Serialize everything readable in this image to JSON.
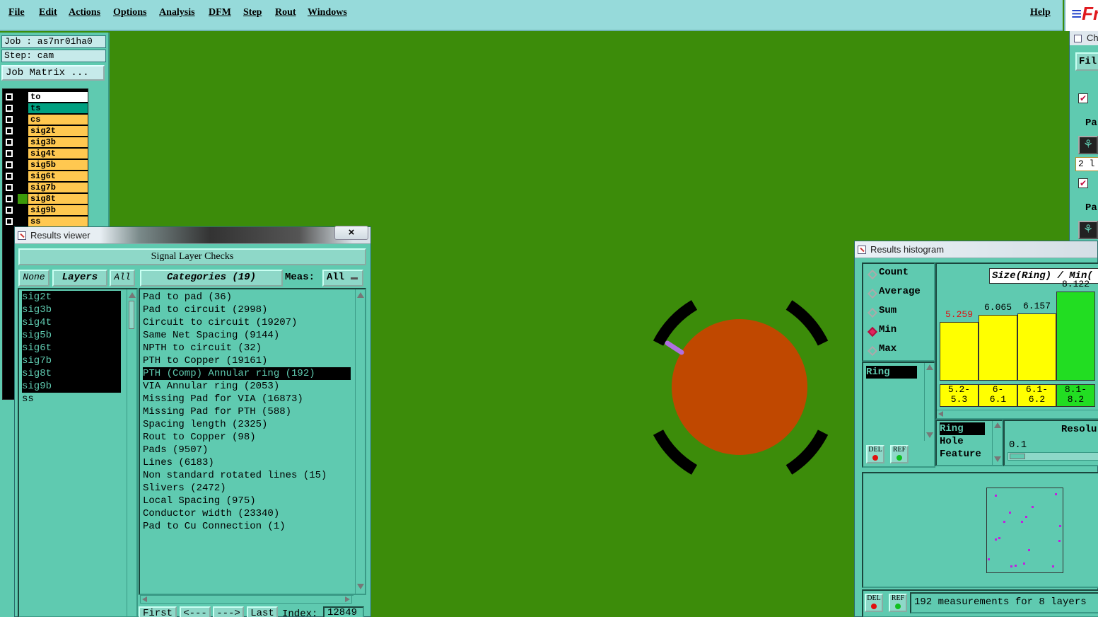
{
  "menu": {
    "items": [
      "File",
      "Edit",
      "Actions",
      "Options",
      "Analysis",
      "DFM",
      "Step",
      "Rout",
      "Windows"
    ],
    "help": "Help",
    "logo": "Fr"
  },
  "job": {
    "job_label": "Job : as7nr01ha0",
    "step_label": "Step: cam",
    "matrix_button": "Job Matrix ..."
  },
  "layers": [
    {
      "name": "to",
      "color": "#ffffff",
      "sw": "#000000"
    },
    {
      "name": "ts",
      "color": "#00a080",
      "sw": "#000000"
    },
    {
      "name": "cs",
      "color": "#ffc850",
      "sw": "#000000"
    },
    {
      "name": "sig2t",
      "color": "#ffc850",
      "sw": "#000000"
    },
    {
      "name": "sig3b",
      "color": "#ffc850",
      "sw": "#000000"
    },
    {
      "name": "sig4t",
      "color": "#ffc850",
      "sw": "#000000"
    },
    {
      "name": "sig5b",
      "color": "#ffc850",
      "sw": "#000000"
    },
    {
      "name": "sig6t",
      "color": "#ffc850",
      "sw": "#000000"
    },
    {
      "name": "sig7b",
      "color": "#ffc850",
      "sw": "#000000"
    },
    {
      "name": "sig8t",
      "color": "#ffc850",
      "sw": "#3c9a0a"
    },
    {
      "name": "sig9b",
      "color": "#ffc850",
      "sw": "#000000"
    },
    {
      "name": "ss",
      "color": "#ffc850",
      "sw": "#000000"
    }
  ],
  "results_viewer": {
    "title": "Results viewer",
    "close": "×",
    "header": "Signal Layer Checks",
    "none_btn": "None",
    "layers_btn": "Layers",
    "all_btn": "All",
    "categories_btn": "Categories (19)",
    "meas_label": "Meas:",
    "meas_value": "All",
    "layer_list": [
      {
        "name": "sig2t",
        "selected": true
      },
      {
        "name": "sig3b",
        "selected": true
      },
      {
        "name": "sig4t",
        "selected": true
      },
      {
        "name": "sig5b",
        "selected": true
      },
      {
        "name": "sig6t",
        "selected": true
      },
      {
        "name": "sig7b",
        "selected": true
      },
      {
        "name": "sig8t",
        "selected": true
      },
      {
        "name": "sig9b",
        "selected": true
      },
      {
        "name": "ss",
        "selected": false
      }
    ],
    "categories": [
      {
        "name": "Pad to pad (36)",
        "selected": false
      },
      {
        "name": "Pad to circuit (2998)",
        "selected": false
      },
      {
        "name": "Circuit to circuit (19207)",
        "selected": false
      },
      {
        "name": "Same Net Spacing (9144)",
        "selected": false
      },
      {
        "name": "NPTH to circuit (32)",
        "selected": false
      },
      {
        "name": "PTH to Copper (19161)",
        "selected": false
      },
      {
        "name": "PTH (Comp) Annular ring (192)",
        "selected": true
      },
      {
        "name": "VIA Annular ring (2053)",
        "selected": false
      },
      {
        "name": "Missing Pad for VIA (16873)",
        "selected": false
      },
      {
        "name": "Missing Pad for PTH (588)",
        "selected": false
      },
      {
        "name": "Spacing length (2325)",
        "selected": false
      },
      {
        "name": "Rout to Copper (98)",
        "selected": false
      },
      {
        "name": "Pads (9507)",
        "selected": false
      },
      {
        "name": "Lines (6183)",
        "selected": false
      },
      {
        "name": "Non standard rotated lines (15)",
        "selected": false
      },
      {
        "name": "Slivers (2472)",
        "selected": false
      },
      {
        "name": "Local Spacing (975)",
        "selected": false
      },
      {
        "name": "Conductor width (23340)",
        "selected": false
      },
      {
        "name": "Pad to Cu Connection (1)",
        "selected": false
      }
    ],
    "nav": {
      "first": "First",
      "prev": "<---",
      "next": "--->",
      "last": "Last",
      "index_label": "Index:",
      "index_value": "12849"
    }
  },
  "histogram": {
    "title": "Results histogram",
    "modes": [
      {
        "label": "Count",
        "on": false
      },
      {
        "label": "Average",
        "on": false
      },
      {
        "label": "Sum",
        "on": false
      },
      {
        "label": "Min",
        "on": true
      },
      {
        "label": "Max",
        "on": false
      }
    ],
    "measure_list": [
      {
        "name": "Ring",
        "selected": true
      }
    ],
    "chart_title": "Size(Ring) / Min(",
    "bars": [
      {
        "value": "5.259",
        "fraction": 0.55,
        "color": "#ffff00",
        "label_color": "#e01010",
        "range": "5.2-\n5.3"
      },
      {
        "value": "6.065",
        "fraction": 0.62,
        "color": "#ffff00",
        "label_color": "#000000",
        "range": "6-\n6.1"
      },
      {
        "value": "6.157",
        "fraction": 0.63,
        "color": "#ffff00",
        "label_color": "#000000",
        "range": "6.1-\n6.2"
      },
      {
        "value": "8.122",
        "fraction": 0.84,
        "color": "#22dd22",
        "label_color": "#000000",
        "range": "8.1-\n8.2"
      }
    ],
    "type_list": [
      {
        "name": "Ring",
        "selected": true
      },
      {
        "name": "Hole",
        "selected": false
      },
      {
        "name": "Feature",
        "selected": false
      }
    ],
    "resolution_label": "Resolu",
    "resolution_value": "0.1",
    "del_label": "DEL",
    "ref_label": "REF",
    "status": "192 measurements for 8 layers"
  },
  "right_strip": {
    "title": "Ch",
    "file": "Fil",
    "pa1": "Pa",
    "pa2": "Pa",
    "field": "2 l"
  }
}
